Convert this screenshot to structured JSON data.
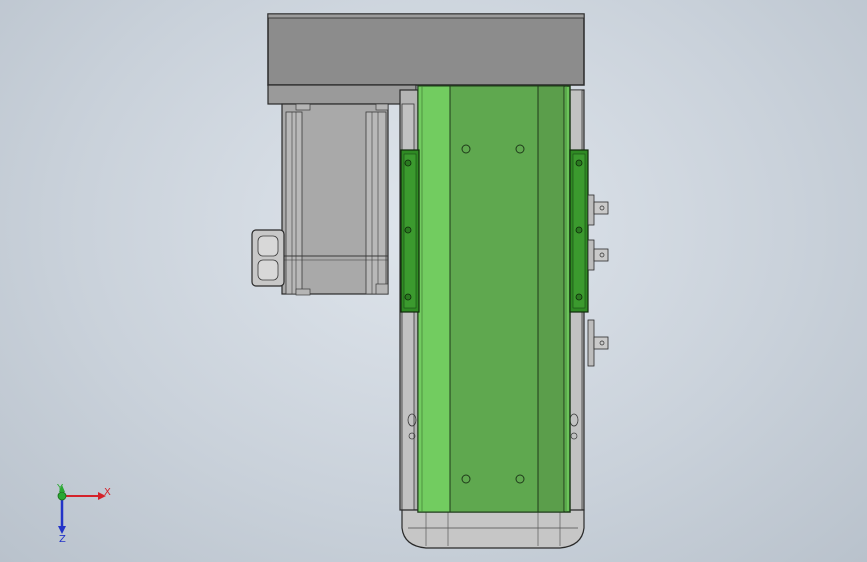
{
  "viewport": {
    "background": "#cfd6de",
    "model": "linear-actuator-module-with-motor"
  },
  "triad": {
    "x_label": "X",
    "y_label": "Y",
    "z_label": "Z",
    "x_color": "#d4222a",
    "y_color": "#2aa832",
    "z_color": "#2233c8"
  },
  "colors": {
    "carriage_green": "#6bc45a",
    "carriage_green_dark": "#5aa84c",
    "rail_green": "#2f8a24",
    "housing_gray": "#8a8a8a",
    "motor_gray": "#a6a6a6",
    "base_gray": "#b4b4b4"
  }
}
